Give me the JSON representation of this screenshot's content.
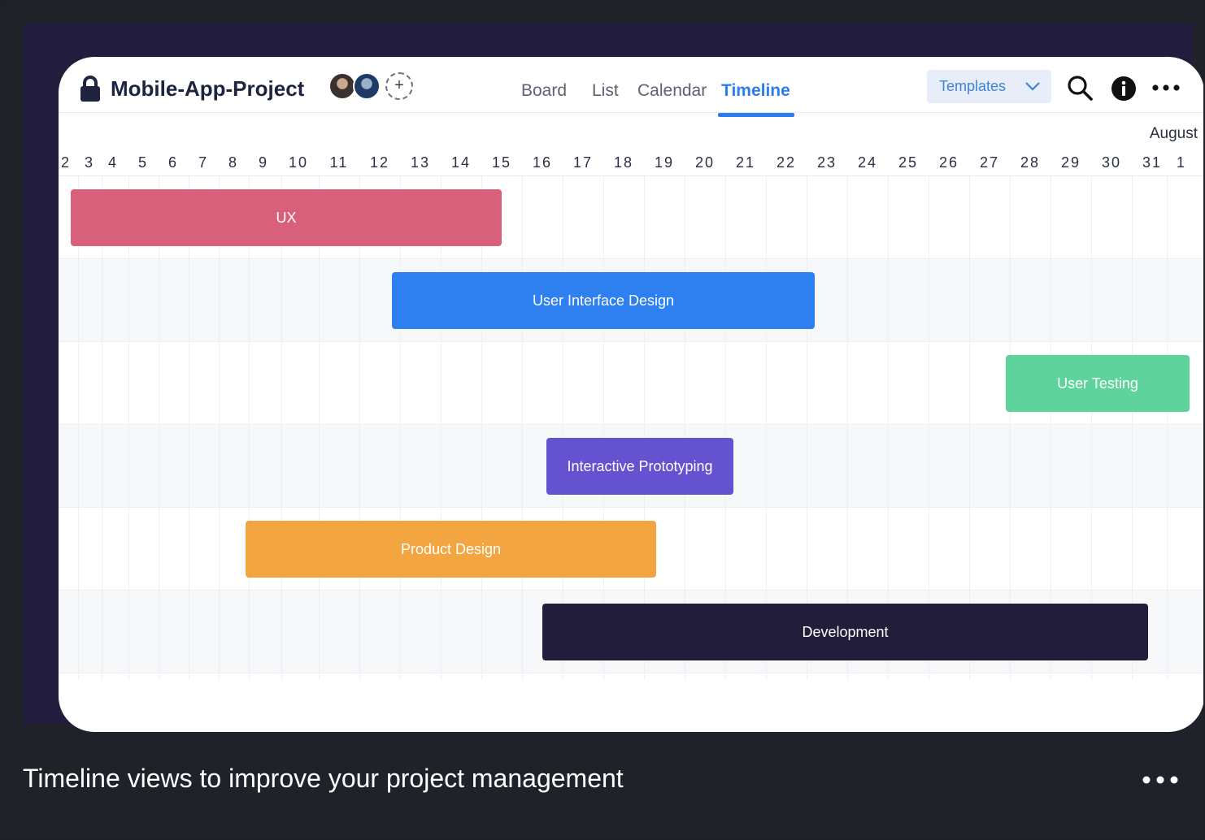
{
  "header": {
    "project_title": "Mobile-App-Project",
    "add_member_symbol": "+",
    "tabs": [
      {
        "id": "board",
        "label": "Board"
      },
      {
        "id": "list",
        "label": "List"
      },
      {
        "id": "calendar",
        "label": "Calendar"
      },
      {
        "id": "timeline",
        "label": "Timeline"
      }
    ],
    "active_tab": "timeline",
    "templates_label": "Templates",
    "icons": [
      "lock-icon",
      "search-icon",
      "info-icon",
      "more-icon",
      "chevron-down-icon"
    ]
  },
  "timeline": {
    "month": "August",
    "days": [
      "2",
      "3",
      "4",
      "5",
      "6",
      "7",
      "8",
      "9",
      "10",
      "11",
      "12",
      "13",
      "14",
      "15",
      "16",
      "17",
      "18",
      "19",
      "20",
      "21",
      "22",
      "23",
      "24",
      "25",
      "26",
      "27",
      "28",
      "29",
      "30",
      "31",
      "1"
    ],
    "tasks": [
      {
        "label": "UX",
        "start_day": 1.2,
        "end_day": 14.0,
        "color": "#d9607a",
        "row": 0
      },
      {
        "label": "User Interface Design",
        "start_day": 11.3,
        "end_day": 21.7,
        "color": "#2e7ff0",
        "row": 1
      },
      {
        "label": "User Testing",
        "start_day": 26.4,
        "end_day": 32.2,
        "color": "#5fd39c",
        "row": 2
      },
      {
        "label": "Interactive Prototyping",
        "start_day": 15.1,
        "end_day": 19.7,
        "color": "#6452d0",
        "row": 3
      },
      {
        "label": "Product Design",
        "start_day": 7.4,
        "end_day": 17.8,
        "color": "#f2a541",
        "row": 4
      },
      {
        "label": "Development",
        "start_day": 15.0,
        "end_day": 29.9,
        "color": "#221d3b",
        "row": 5
      }
    ],
    "accent_color": "#2b7cf0"
  },
  "footer": {
    "caption": "Timeline views to improve your project management"
  }
}
